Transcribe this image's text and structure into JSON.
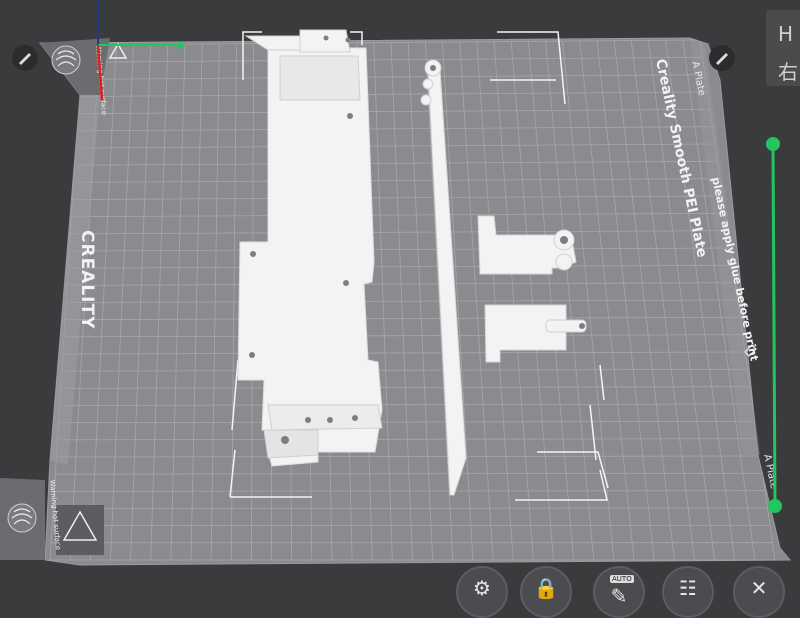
{
  "plate": {
    "brand": "CREALITY",
    "title": "Creality Smooth PEI Plate",
    "note": "please apply glue before print",
    "side_label_top": "A Plate",
    "side_label_bottom": "A Plate",
    "warning_top": "Warning hot surface",
    "warning_bottom": "Warning hot surface"
  },
  "tooltip": {
    "line1": "H",
    "line2": "右"
  },
  "toolbar": {
    "buttons": [
      {
        "name": "settings",
        "icon": "gear-icon",
        "glyph": "⚙"
      },
      {
        "name": "lock",
        "icon": "lock-icon",
        "glyph": "🔒"
      },
      {
        "name": "auto-arrange",
        "icon": "auto-icon",
        "glyph": "✎",
        "badge": "AUTO"
      },
      {
        "name": "layout",
        "icon": "grid-icon",
        "glyph": "☷"
      },
      {
        "name": "close",
        "icon": "close-icon",
        "glyph": "✕"
      }
    ]
  },
  "colors": {
    "background": "#3a3b3d",
    "plate": "#898a8d",
    "grid": "#a3a4a7",
    "model": "#f2f2f2",
    "layer_slider": "#22c55e",
    "axis_x": "#22c55e",
    "axis_y": "#e11d1d",
    "axis_z": "#1e3a8a"
  }
}
